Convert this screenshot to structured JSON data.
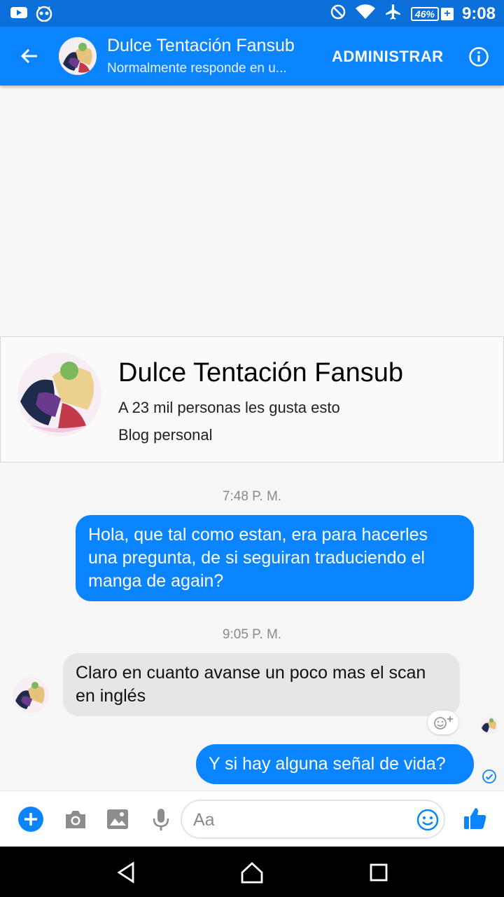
{
  "status_bar": {
    "left_icons": [
      "youtube-icon",
      "robot-app-icon"
    ],
    "right_icons": [
      "do-not-disturb-icon",
      "wifi-icon",
      "airplane-icon"
    ],
    "battery": "46%",
    "time": "9:08"
  },
  "header": {
    "title": "Dulce Tentación Fansub",
    "subtitle": "Normalmente responde en u...",
    "manage_label": "ADMINISTRAR",
    "back_icon": "arrow-back-icon",
    "info_icon": "info-icon"
  },
  "page_card": {
    "name": "Dulce Tentación Fansub",
    "likes": "A 23 mil personas les gusta esto",
    "category": "Blog personal"
  },
  "messages": [
    {
      "timestamp": "7:48 P. M."
    },
    {
      "direction": "outgoing",
      "text": "Hola, que tal como estan, era para hacerles una pregunta, de si seguiran traduciendo el manga de again?"
    },
    {
      "timestamp": "9:05 P. M."
    },
    {
      "direction": "incoming",
      "text": "Claro en cuanto avanse un poco mas el scan en inglés"
    },
    {
      "direction": "outgoing",
      "text": "Y si hay alguna señal de vida?"
    }
  ],
  "composer": {
    "placeholder": "Aa",
    "icons": [
      "add-icon",
      "camera-icon",
      "image-icon",
      "microphone-icon",
      "emoji-icon",
      "like-thumb-icon"
    ]
  },
  "navbar": {
    "icons": [
      "nav-back-icon",
      "nav-home-icon",
      "nav-recents-icon"
    ]
  },
  "colors": {
    "brand_blue": "#0a84ff",
    "status_bar_blue": "#0a6fd8",
    "incoming_bubble": "#e6e6e6"
  }
}
